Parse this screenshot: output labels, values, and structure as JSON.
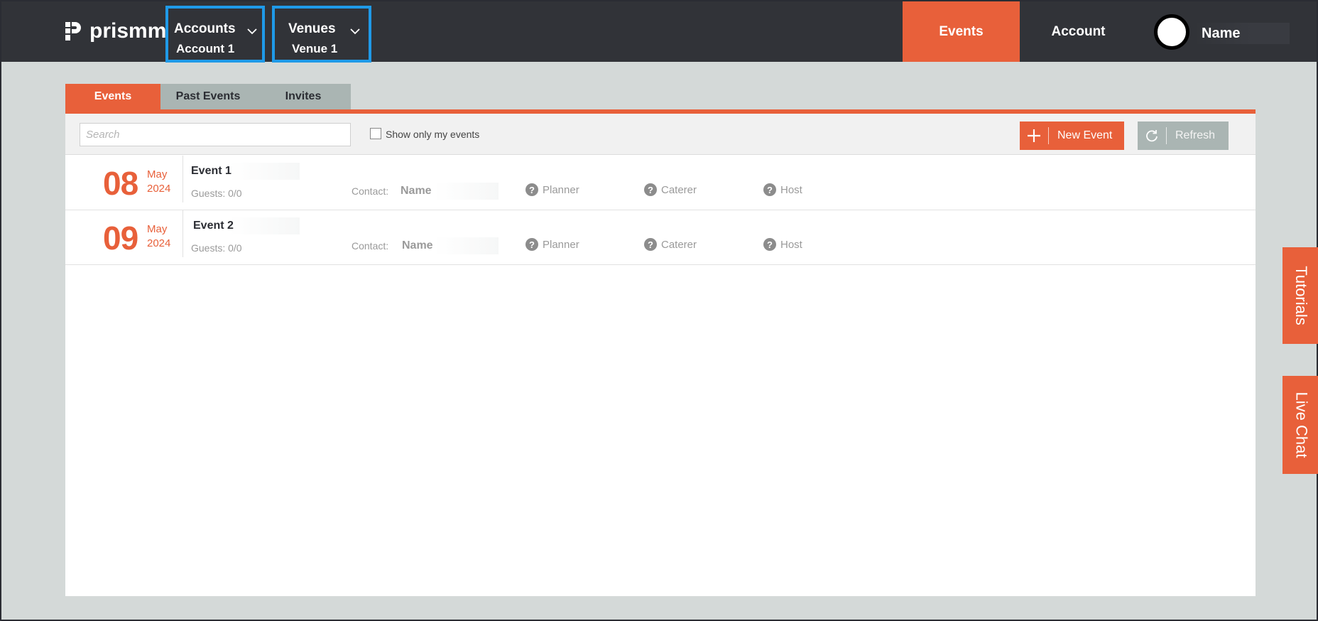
{
  "brand": {
    "name": "prismm",
    "accent": "#e8603a",
    "dark": "#313338",
    "highlight": "#1f9ae8"
  },
  "header": {
    "accounts": {
      "title": "Accounts",
      "selected": "Account 1"
    },
    "venues": {
      "title": "Venues",
      "selected": "Venue 1"
    },
    "nav": {
      "events": "Events",
      "account": "Account"
    },
    "user_name": "Name"
  },
  "tabs": [
    "Events",
    "Past Events",
    "Invites"
  ],
  "toolbar": {
    "search_placeholder": "Search",
    "only_mine_label": "Show only my events",
    "new_event": "New Event",
    "refresh": "Refresh"
  },
  "events": [
    {
      "day": "08",
      "month": "May",
      "year": "2024",
      "name": "Event 1",
      "guests": "Guests: 0/0",
      "contact_label": "Contact:",
      "contact_name": "Name",
      "planner": "Planner",
      "caterer": "Caterer",
      "host": "Host"
    },
    {
      "day": "09",
      "month": "May",
      "year": "2024",
      "name": "Event 2",
      "guests": "Guests: 0/0",
      "contact_label": "Contact:",
      "contact_name": "Name",
      "planner": "Planner",
      "caterer": "Caterer",
      "host": "Host"
    }
  ],
  "side": {
    "tutorials": "Tutorials",
    "live_chat": "Live Chat"
  }
}
